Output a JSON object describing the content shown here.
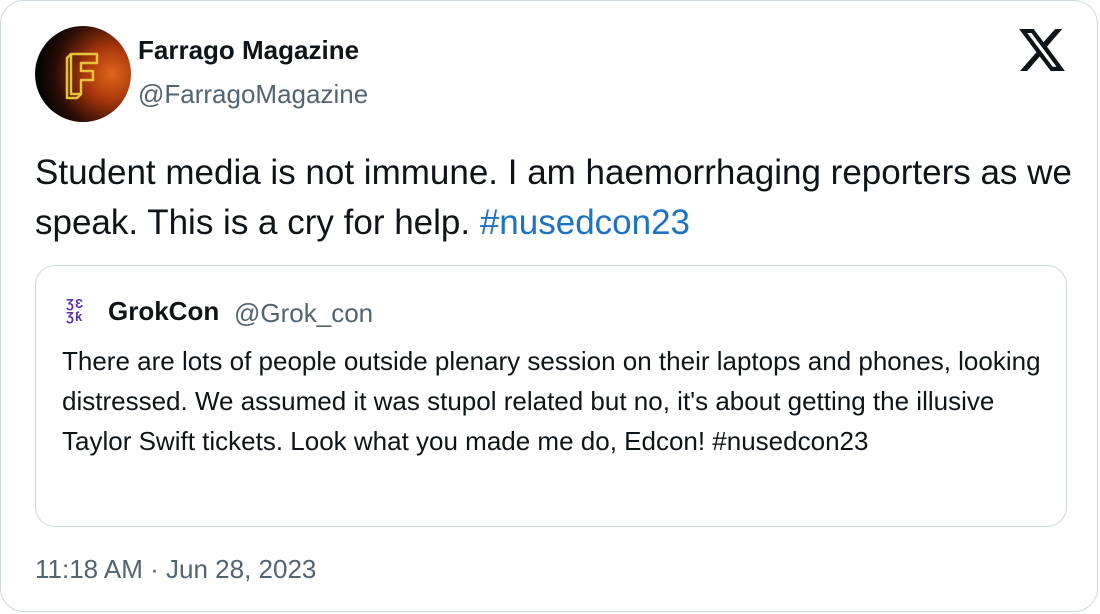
{
  "author": {
    "name": "Farrago Magazine",
    "handle": "@FarragoMagazine",
    "avatar_letter": "F"
  },
  "tweet": {
    "text": "Student media is not immune. I am haemorrhaging reporters as we speak. This is a cry for help.",
    "hashtag": "#nusedcon23"
  },
  "quoted": {
    "name": "GrokCon",
    "handle": "@Grok_con",
    "avatar_glyph_top": "ƷƐ",
    "avatar_glyph_bottom": "Ʒƙ",
    "text": "There are lots of people outside plenary session on their laptops and phones, looking distressed. We assumed it was stupol related but no, it's about getting the illusive Taylor Swift tickets. Look what you made me do, Edcon! #nusedcon23"
  },
  "timestamp": "11:18 AM · Jun 28, 2023",
  "icons": {
    "platform": "x-logo-icon"
  },
  "colors": {
    "text": "#0f1419",
    "secondary": "#536471",
    "hashtag": "#1d72c4",
    "border": "#cfd9de"
  }
}
